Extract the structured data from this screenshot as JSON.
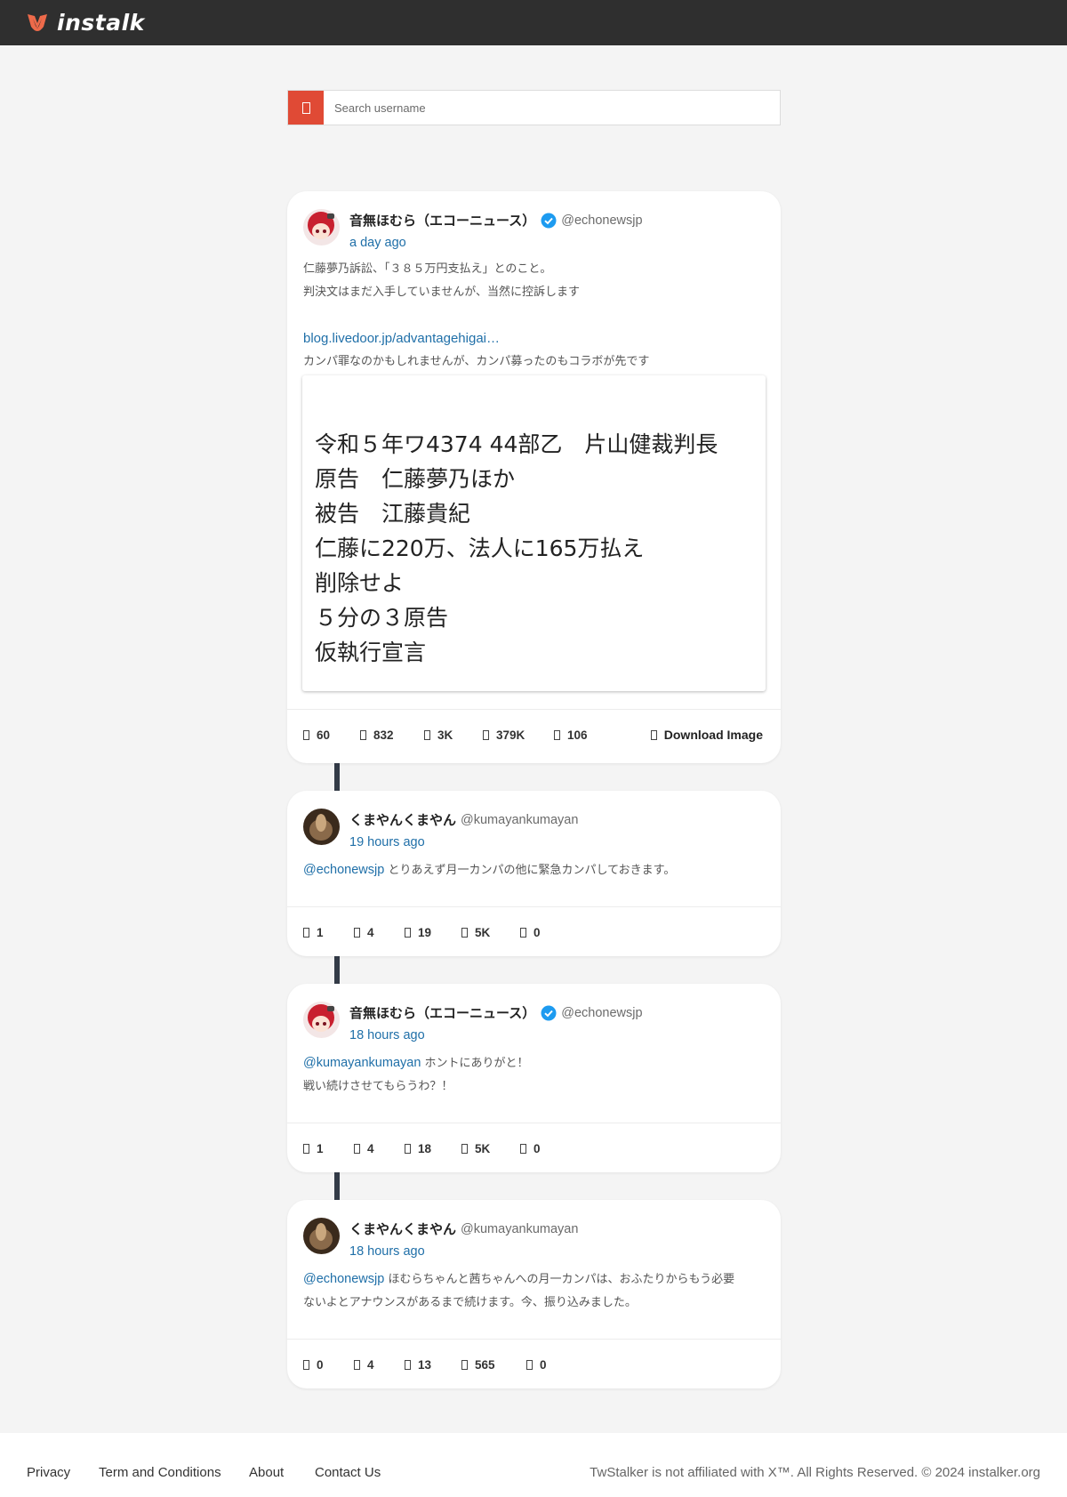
{
  "app": {
    "logo_text": "instalk"
  },
  "search": {
    "placeholder": "Search username",
    "value": ""
  },
  "posts": [
    {
      "name": "音無ほむら（エコーニュース）",
      "handle": "@echonewsjp",
      "verified": true,
      "time": "a day ago",
      "lines": [
        "仁藤夢乃訴訟、「３８５万円支払え」とのこと。",
        "判決文はまだ入手していませんが、当然に控訴します"
      ],
      "link": "blog.livedoor.jp/advantagehigai…",
      "link_caption": "カンパ罪なのかもしれませんが、カンパ募ったのもコラボが先です",
      "media_lines": [
        "令和５年ワ4374 44部乙　片山健裁判長",
        "原告　仁藤夢乃ほか",
        "被告　江藤貴紀",
        "仁藤に220万、法人に165万払え",
        "削除せよ",
        "５分の３原告",
        "仮執行宣言"
      ],
      "stats": [
        "60",
        "832",
        "3K",
        "379K",
        "106"
      ],
      "download_label": "Download Image"
    },
    {
      "name": "くまやんくまやん",
      "handle": "@kumayankumayan",
      "verified": false,
      "time": "19 hours ago",
      "mention": "@echonewsjp",
      "text1": "とりあえず月一カンパの他に緊急カンパしておきます。",
      "stats": [
        "1",
        "4",
        "19",
        "5K",
        "0"
      ]
    },
    {
      "name": "音無ほむら（エコーニュース）",
      "handle": "@echonewsjp",
      "verified": true,
      "time": "18 hours ago",
      "mention": "@kumayankumayan",
      "text1": "ホントにありがと！",
      "text2": "戦い続けさせてもらうわ？！",
      "stats": [
        "1",
        "4",
        "18",
        "5K",
        "0"
      ]
    },
    {
      "name": "くまやんくまやん",
      "handle": "@kumayankumayan",
      "verified": false,
      "time": "18 hours ago",
      "mention": "@echonewsjp",
      "text1": "ほむらちゃんと茜ちゃんへの月一カンパは、おふたりからもう必要",
      "text2": "ないよとアナウンスがあるまで続けます。今、振り込みました。",
      "stats": [
        "0",
        "4",
        "13",
        "565",
        "0"
      ]
    }
  ],
  "footer": {
    "links": [
      "Privacy",
      "Term and Conditions",
      "About",
      "Contact Us"
    ],
    "copyright": "TwStalker is not affiliated with X™. All Rights Reserved. © 2024 instalker.org"
  },
  "colors": {
    "topbar": "#2f2f2f",
    "accent": "#e04a35",
    "link": "#1f6fa8",
    "connector": "#333b47"
  },
  "icons": [
    "logo-icon",
    "search-icon",
    "verified-icon",
    "reply-icon",
    "retweet-icon",
    "like-icon",
    "view-icon",
    "bookmark-icon",
    "download-icon"
  ]
}
